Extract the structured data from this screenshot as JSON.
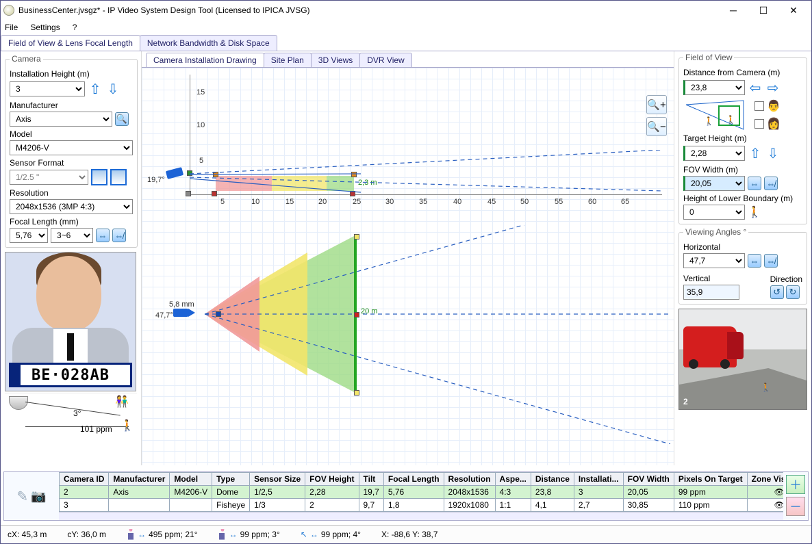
{
  "window_title": "BusinessCenter.jvsgz* - IP Video System Design Tool (Licensed to IPICA JVSG)",
  "menu": {
    "file": "File",
    "settings": "Settings",
    "help": "?"
  },
  "toptabs": {
    "fov": "Field of View & Lens Focal Length",
    "net": "Network Bandwidth & Disk Space"
  },
  "subtabs": {
    "draw": "Camera Installation Drawing",
    "plan": "Site Plan",
    "views3d": "3D Views",
    "dvr": "DVR View"
  },
  "camera": {
    "legend": "Camera",
    "install_h_lbl": "Installation Height (m)",
    "install_h": "3",
    "mfr_lbl": "Manufacturer",
    "mfr": "Axis",
    "model_lbl": "Model",
    "model": "M4206-V",
    "sensor_lbl": "Sensor Format",
    "sensor": "1/2.5 \"",
    "res_lbl": "Resolution",
    "res": "2048x1536 (3MP 4:3)",
    "focal_lbl": "Focal Length (mm)",
    "focal": "5,76",
    "focal_range": "3~6"
  },
  "preview": {
    "plate": "BE·028AB",
    "angle": "3°",
    "ppm": "101 ppm"
  },
  "drawing": {
    "side": {
      "angle": "19,7°",
      "target_label": "2,3 m",
      "xticks": [
        "5",
        "10",
        "15",
        "20",
        "25",
        "30",
        "35",
        "40",
        "45",
        "50",
        "55",
        "60",
        "65"
      ],
      "yticks": [
        "5",
        "10",
        "15"
      ]
    },
    "top": {
      "lens": "5,8 mm",
      "hfov": "47,7°",
      "width": "20 m"
    }
  },
  "fov": {
    "legend": "Field of View",
    "dist_lbl": "Distance from Camera  (m)",
    "dist": "23,8",
    "th_lbl": "Target Height (m)",
    "th": "2,28",
    "fw_lbl": "FOV Width (m)",
    "fw": "20,05",
    "hlb_lbl": "Height of Lower Boundary (m)",
    "hlb": "0"
  },
  "angles": {
    "legend": "Viewing Angles °",
    "h_lbl": "Horizontal",
    "h": "47,7",
    "v_lbl": "Vertical",
    "v": "35,9",
    "dir_lbl": "Direction"
  },
  "threeD": {
    "camno": "2"
  },
  "table": {
    "headers": [
      "Camera ID",
      "Manufacturer",
      "Model",
      "Type",
      "Sensor Size",
      "FOV Height",
      "Tilt",
      "Focal Length",
      "Resolution",
      "Aspe...",
      "Distance",
      "Installati...",
      "FOV Width",
      "Pixels On Target",
      "Zone Visibility"
    ],
    "rows": [
      {
        "sel": true,
        "cells": [
          "2",
          "Axis",
          "M4206-V",
          "Dome",
          "1/2,5",
          "2,28",
          "19,7",
          "5,76",
          "2048x1536",
          "4:3",
          "23,8",
          "3",
          "20,05",
          "99 ppm",
          ""
        ]
      },
      {
        "sel": false,
        "cells": [
          "3",
          "",
          "",
          "Fisheye",
          "1/3",
          "2",
          "9,7",
          "1,8",
          "1920x1080",
          "1:1",
          "4,1",
          "2,7",
          "30,85",
          "110 ppm",
          ""
        ]
      }
    ]
  },
  "status": {
    "cx": "cX: 45,3 m",
    "cy": "cY: 36,0 m",
    "p1": "495 ppm; 21°",
    "p2": "99 ppm; 3°",
    "p3": "99 ppm; 4°",
    "xy": "X: -88,6 Y: 38,7"
  }
}
